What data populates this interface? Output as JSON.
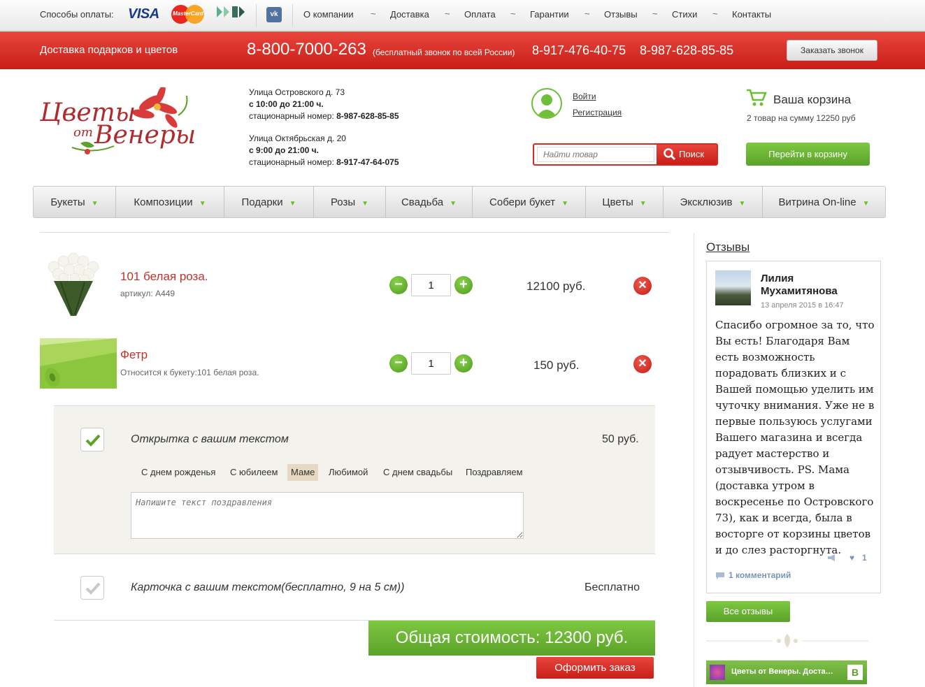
{
  "topbar": {
    "payment_label": "Способы оплаты:",
    "visa": "VISA",
    "mastercard": "MasterCard",
    "vk": "vk",
    "nav": [
      "О компании",
      "Доставка",
      "Оплата",
      "Гарантии",
      "Отзывы",
      "Стихи",
      "Контакты"
    ],
    "separator": "~"
  },
  "redbar": {
    "slogan": "Доставка подарков и цветов",
    "phone_main": "8-800-7000-263",
    "phone_note": "(бесплатный звонок по всей России)",
    "phone2": "8-917-476-40-75",
    "phone3": "8-987-628-85-85",
    "callback_label": "Заказать звонок"
  },
  "header": {
    "logo_text": "Цветы от Венеры",
    "addresses": [
      {
        "street": "Улица Островского д. 73",
        "hours": "с 10:00 до 21:00 ч.",
        "phone_label": "стационарный номер:",
        "phone": "8-987-628-85-85"
      },
      {
        "street": "Улица Октябрьская д. 20",
        "hours": "с 9:00 до 21:00 ч.",
        "phone_label": "стационарный номер:",
        "phone": "8-917-47-64-075"
      }
    ],
    "login": "Войти",
    "register": "Регистрация",
    "search_placeholder": "Найти товар",
    "search_button": "Поиск",
    "cart_title": "Ваша корзина",
    "cart_summary": "2 товар на сумму 12250 руб",
    "go_to_cart": "Перейти в корзину"
  },
  "mainnav": [
    "Букеты",
    "Композиции",
    "Подарки",
    "Розы",
    "Свадьба",
    "Собери букет",
    "Цветы",
    "Эксклюзив",
    "Витрина On-line"
  ],
  "cart": {
    "items": [
      {
        "name": "101 белая роза.",
        "sub": "артикул: A449",
        "qty": "1",
        "price": "12100 руб."
      },
      {
        "name": "Фетр",
        "sub": "Относится к букету:101 белая роза.",
        "qty": "1",
        "price": "150 руб."
      }
    ],
    "postcard": {
      "title": "Открытка с вашим текстом",
      "price": "50 руб.",
      "tags": [
        "С днем рожденья",
        "С юбилеем",
        "Маме",
        "Любимой",
        "С днем свадьбы",
        "Поздравляем"
      ],
      "active_tag": "Маме",
      "text_placeholder": "Напишите текст поздравления"
    },
    "card": {
      "title": "Карточка с вашим текстом(бесплатно, 9 на 5 см))",
      "price": "Бесплатно"
    },
    "total": "Общая стоимость: 12300 руб.",
    "checkout": "Оформить заказ"
  },
  "sidebar": {
    "reviews_title": "Отзывы",
    "review": {
      "author": "Лилия Мухамитянова",
      "date": "13 апреля 2015 в 16:47",
      "text": "Спасибо огромное за то, что Вы есть! Благодаря Вам есть возможность порадовать близких и с Вашей помощью уделить им чуточку внимания. Уже не в первые пользуюсь услугами Вашего магазина и всегда радует мастерство и отзывчивость. PS. Мама (доставка утром в воскресенье по Островского 73), как и всегда, была в восторге от корзины цветов и до слез расторгнута.",
      "likes": "1",
      "comments": "1 комментарий"
    },
    "all_reviews": "Все отзывы",
    "vk_widget": "Цветы от Венеры. Доста…",
    "vk_badge": "В"
  },
  "colors": {
    "red": "#d42c22",
    "green": "#5aa22a",
    "link_red": "#c3312a"
  }
}
